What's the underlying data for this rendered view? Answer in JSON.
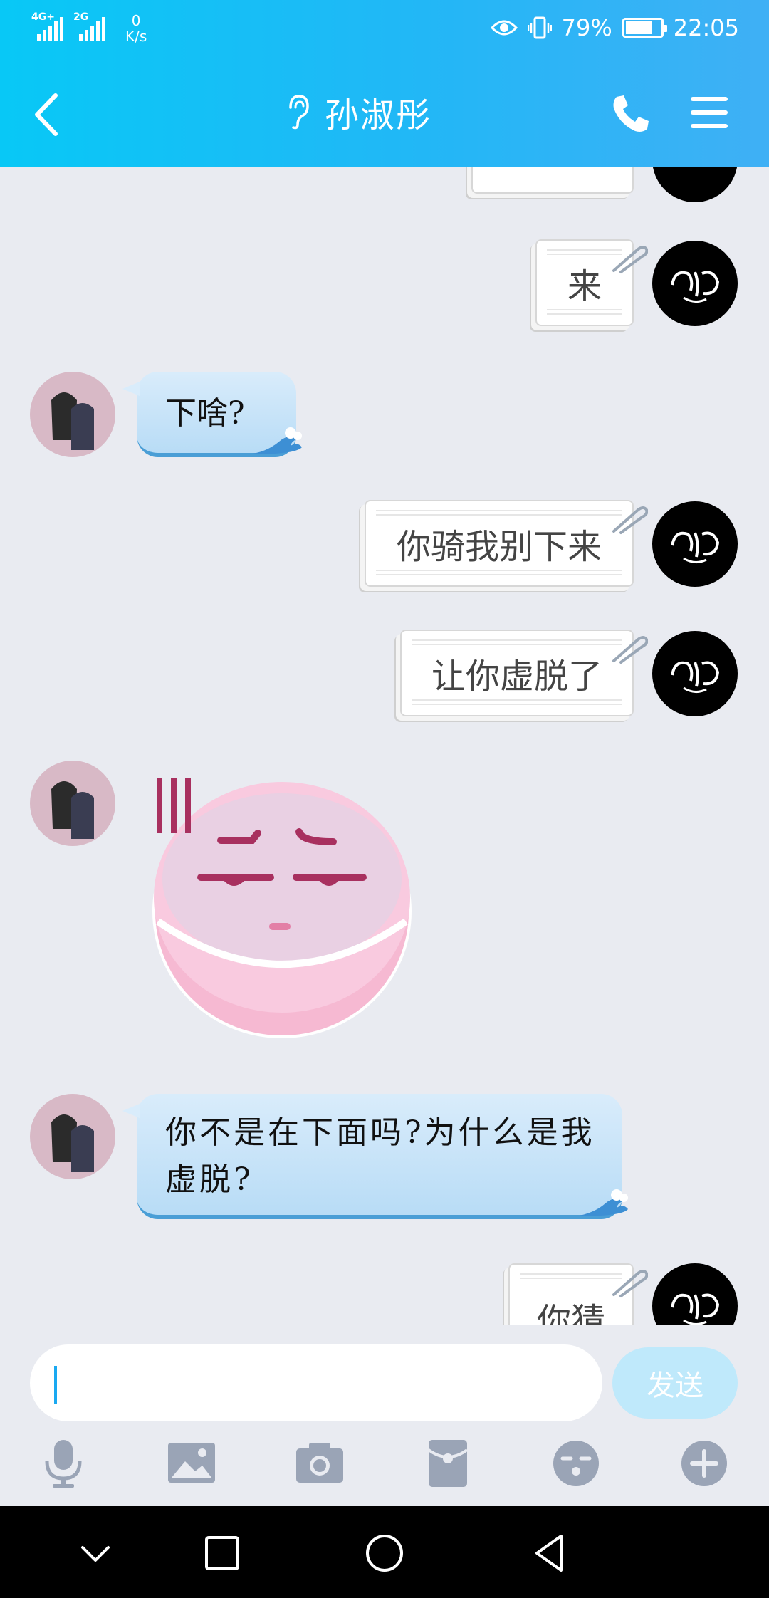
{
  "status": {
    "network1": "4G+",
    "network2": "2G",
    "speed_value": "0",
    "speed_unit": "K/s",
    "battery": "79%",
    "battery_level": 0.79,
    "time": "22:05"
  },
  "header": {
    "title": "孙淑彤"
  },
  "messages": [
    {
      "side": "right",
      "text": "来"
    },
    {
      "side": "left",
      "text": "下啥?"
    },
    {
      "side": "right",
      "text": "你骑我别下来"
    },
    {
      "side": "right",
      "text": "让你虚脱了"
    },
    {
      "side": "left",
      "type": "sticker",
      "icon": "pink-face-sticker"
    },
    {
      "side": "left",
      "text": "你不是在下面吗?为什么是我虚脱?"
    },
    {
      "side": "right",
      "text": "你猜"
    }
  ],
  "input": {
    "value": "",
    "send_label": "发送"
  },
  "toolbar": [
    "mic-icon",
    "image-icon",
    "camera-icon",
    "red-packet-icon",
    "emoji-icon",
    "plus-icon"
  ],
  "colors": {
    "header_start": "#08c8f6",
    "header_end": "#3fb0f5",
    "chat_bg": "#e9ebf1",
    "send_disabled": "#bfe9fb"
  }
}
